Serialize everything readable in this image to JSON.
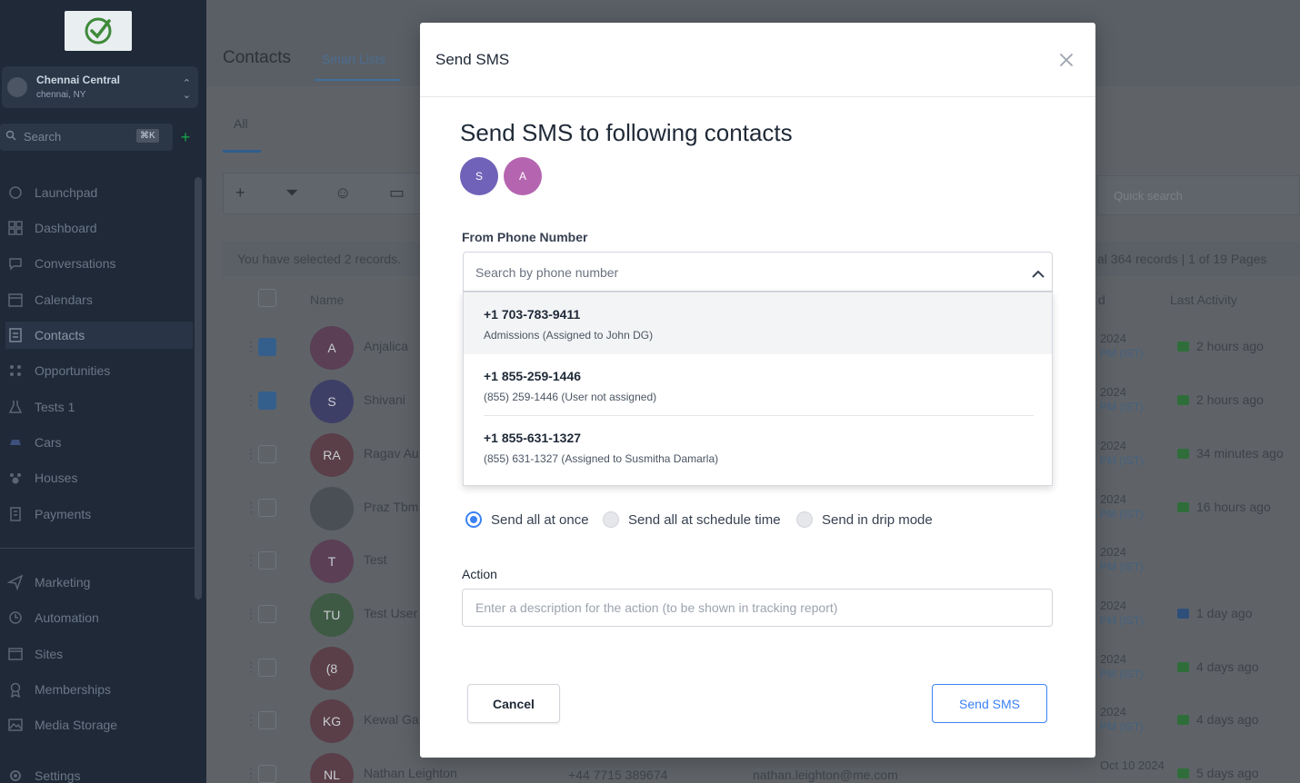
{
  "sidebar": {
    "location_name": "Chennai Central",
    "location_sub": "chennai, NY",
    "search_placeholder": "Search",
    "search_shortcut": "⌘K",
    "items": [
      {
        "label": "Launchpad",
        "icon": "rocket-icon"
      },
      {
        "label": "Dashboard",
        "icon": "grid-icon"
      },
      {
        "label": "Conversations",
        "icon": "chat-icon"
      },
      {
        "label": "Calendars",
        "icon": "calendar-icon"
      },
      {
        "label": "Contacts",
        "icon": "contacts-icon"
      },
      {
        "label": "Opportunities",
        "icon": "funnel-icon"
      },
      {
        "label": "Tests 1",
        "icon": "flask-icon"
      },
      {
        "label": "Cars",
        "icon": "car-icon"
      },
      {
        "label": "Houses",
        "icon": "paw-icon"
      },
      {
        "label": "Payments",
        "icon": "receipt-icon"
      },
      {
        "label": "Marketing",
        "icon": "send-icon"
      },
      {
        "label": "Automation",
        "icon": "automation-icon"
      },
      {
        "label": "Sites",
        "icon": "sites-icon"
      },
      {
        "label": "Memberships",
        "icon": "award-icon"
      },
      {
        "label": "Media Storage",
        "icon": "image-icon"
      },
      {
        "label": "Settings",
        "icon": "gear-icon"
      }
    ]
  },
  "contacts_page": {
    "title": "Contacts",
    "tab_smart_lists": "Smart Lists",
    "tab_all": "All",
    "quick_search_placeholder": "Quick search",
    "selection_info": "You have selected 2 records.",
    "records_info": "al 364 records | 1 of 19 Pages",
    "col_name": "Name",
    "col_d": "d",
    "col_last_activity": "Last Activity",
    "rows": [
      {
        "initials": "A",
        "name": "Anjalica",
        "date": "2024",
        "time": "PM (IST)",
        "activity": "2 hours ago",
        "checked": true,
        "avatar_color": "#5a3f55",
        "act_color": "#2f6e3a"
      },
      {
        "initials": "S",
        "name": "Shivani",
        "date": "2024",
        "time": "PM (IST)",
        "activity": "2 hours ago",
        "checked": true,
        "avatar_color": "#3e3f66",
        "act_color": "#2f6e3a"
      },
      {
        "initials": "RA",
        "name": "Ragav Au",
        "date": "2024",
        "time": "PM (IST)",
        "activity": "34 minutes ago",
        "checked": false,
        "avatar_color": "#5a3f48",
        "act_color": "#2f6e3a"
      },
      {
        "initials": "",
        "name": "Praz Tbm",
        "date": "2024",
        "time": "PM (IST)",
        "activity": "16 hours ago",
        "checked": false,
        "avatar_color": "#4a4f56",
        "act_color": "#2f6e3a"
      },
      {
        "initials": "T",
        "name": "Test",
        "date": "2024",
        "time": "PM (IST)",
        "activity": "",
        "checked": false,
        "avatar_color": "#5a3f55",
        "act_color": ""
      },
      {
        "initials": "TU",
        "name": "Test User",
        "date": "2024",
        "time": "PM (IST)",
        "activity": "1 day ago",
        "checked": false,
        "avatar_color": "#3f5a44",
        "act_color": "#2e4f7a"
      },
      {
        "initials": "(8",
        "name": "",
        "date": "2024",
        "time": "PM (IST)",
        "activity": "4 days ago",
        "checked": false,
        "avatar_color": "#5a3f48",
        "act_color": "#2f6e3a"
      },
      {
        "initials": "KG",
        "name": "Kewal Ga",
        "date": "2024",
        "time": "PM (IST)",
        "activity": "4 days ago",
        "checked": false,
        "avatar_color": "#5a3f48",
        "act_color": "#2f6e3a"
      },
      {
        "initials": "NL",
        "name": "Nathan Leighton",
        "date": "Oct 10 2024",
        "time": "",
        "activity": "5 days ago",
        "checked": false,
        "avatar_color": "#5a3f48",
        "act_color": "#2f6e3a"
      }
    ],
    "bottom_phone": "+44 7715 389674",
    "bottom_email": "nathan.leighton@me.com"
  },
  "modal": {
    "title": "Send SMS",
    "heading": "Send SMS to following contacts",
    "recipients": [
      {
        "initial": "S",
        "color": "#6f62b8"
      },
      {
        "initial": "A",
        "color": "#b565b0"
      }
    ],
    "from_label": "From Phone Number",
    "search_placeholder": "Search by phone number",
    "phone_options": [
      {
        "number": "+1 703-783-9411",
        "detail": "Admissions (Assigned to John DG)"
      },
      {
        "number": "+1 855-259-1446",
        "detail": "(855) 259-1446 (User not assigned)"
      },
      {
        "number": "+1 855-631-1327",
        "detail": "(855) 631-1327 (Assigned to Susmitha Damarla)"
      }
    ],
    "send_modes": [
      {
        "label": "Send all at once",
        "selected": true
      },
      {
        "label": "Send all at schedule time",
        "selected": false
      },
      {
        "label": "Send in drip mode",
        "selected": false
      }
    ],
    "action_label": "Action",
    "action_placeholder": "Enter a description for the action (to be shown in tracking report)",
    "cancel_label": "Cancel",
    "send_label": "Send SMS"
  },
  "colors": {
    "accent": "#3b82f6",
    "overlay": "#5f6368"
  }
}
